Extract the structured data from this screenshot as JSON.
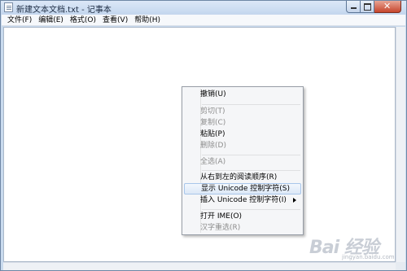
{
  "window": {
    "title": "新建文本文档.txt - 记事本",
    "controls": {
      "minimize": "",
      "maximize": "",
      "close": "✕"
    }
  },
  "menubar": [
    {
      "label": "文件(F)"
    },
    {
      "label": "编辑(E)"
    },
    {
      "label": "格式(O)"
    },
    {
      "label": "查看(V)"
    },
    {
      "label": "帮助(H)"
    }
  ],
  "context_menu": {
    "items": [
      {
        "label": "撤销(U)",
        "enabled": true
      },
      {
        "label": "剪切(T)",
        "enabled": false
      },
      {
        "label": "复制(C)",
        "enabled": false
      },
      {
        "label": "粘贴(P)",
        "enabled": true
      },
      {
        "label": "删除(D)",
        "enabled": false
      },
      {
        "label": "全选(A)",
        "enabled": false
      },
      {
        "label": "从右到左的阅读顺序(R)",
        "enabled": true
      },
      {
        "label": "显示 Unicode 控制字符(S)",
        "enabled": true,
        "highlighted": true
      },
      {
        "label": "插入 Unicode 控制字符(I)",
        "enabled": true,
        "submenu": true
      },
      {
        "label": "打开 IME(O)",
        "enabled": true
      },
      {
        "label": "汉字重选(R)",
        "enabled": false
      }
    ]
  },
  "watermark": {
    "logo": "Bai 经验",
    "url": "jingyan.baidu.com"
  },
  "colors": {
    "accent": "#a8c6ea",
    "close_button": "#c6452c",
    "disabled_text": "#8d8d8d"
  }
}
